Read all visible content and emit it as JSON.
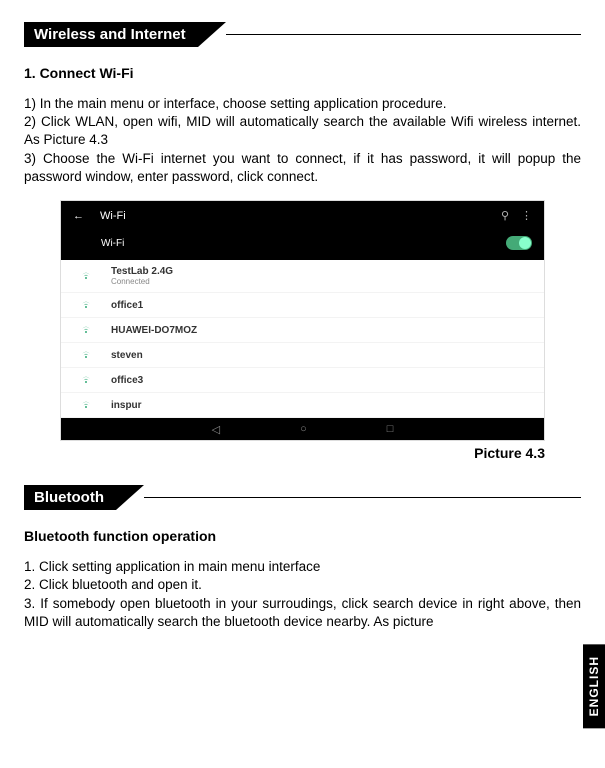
{
  "sectionA": {
    "header": "Wireless and Internet",
    "subtitle": "1. Connect Wi-Fi",
    "p1": "1)  In the main menu or interface, choose setting application procedure.",
    "p2": "2) Click WLAN, open wifi, MID will automatically search the available Wifi wireless internet. As Picture 4.3",
    "p3": "3) Choose the Wi-Fi internet you want to connect, if it has password, it will popup the password window, enter password, click connect."
  },
  "figure": {
    "back": "←",
    "title": "Wi-Fi",
    "searchIcon": "⚲",
    "menuIcon": "⋮",
    "toggleLabel": "Wi-Fi",
    "rows": [
      {
        "name": "TestLab 2.4G",
        "sub": "Connected"
      },
      {
        "name": "office1",
        "sub": ""
      },
      {
        "name": "HUAWEI-DO7MOZ",
        "sub": ""
      },
      {
        "name": "steven",
        "sub": ""
      },
      {
        "name": "office3",
        "sub": ""
      },
      {
        "name": "inspur",
        "sub": ""
      }
    ],
    "caption": "Picture 4.3",
    "navBack": "◁",
    "navHome": "○",
    "navRecent": "□"
  },
  "sectionB": {
    "header": "Bluetooth",
    "subtitle": "Bluetooth function operation",
    "p1": "1. Click setting application in main menu interface",
    "p2": "2. Click bluetooth and open it.",
    "p3": "3. If somebody open bluetooth in your surroudings, click search device in right above, then MID will automatically search the bluetooth device nearby. As picture"
  },
  "langTab": "ENGLISH"
}
